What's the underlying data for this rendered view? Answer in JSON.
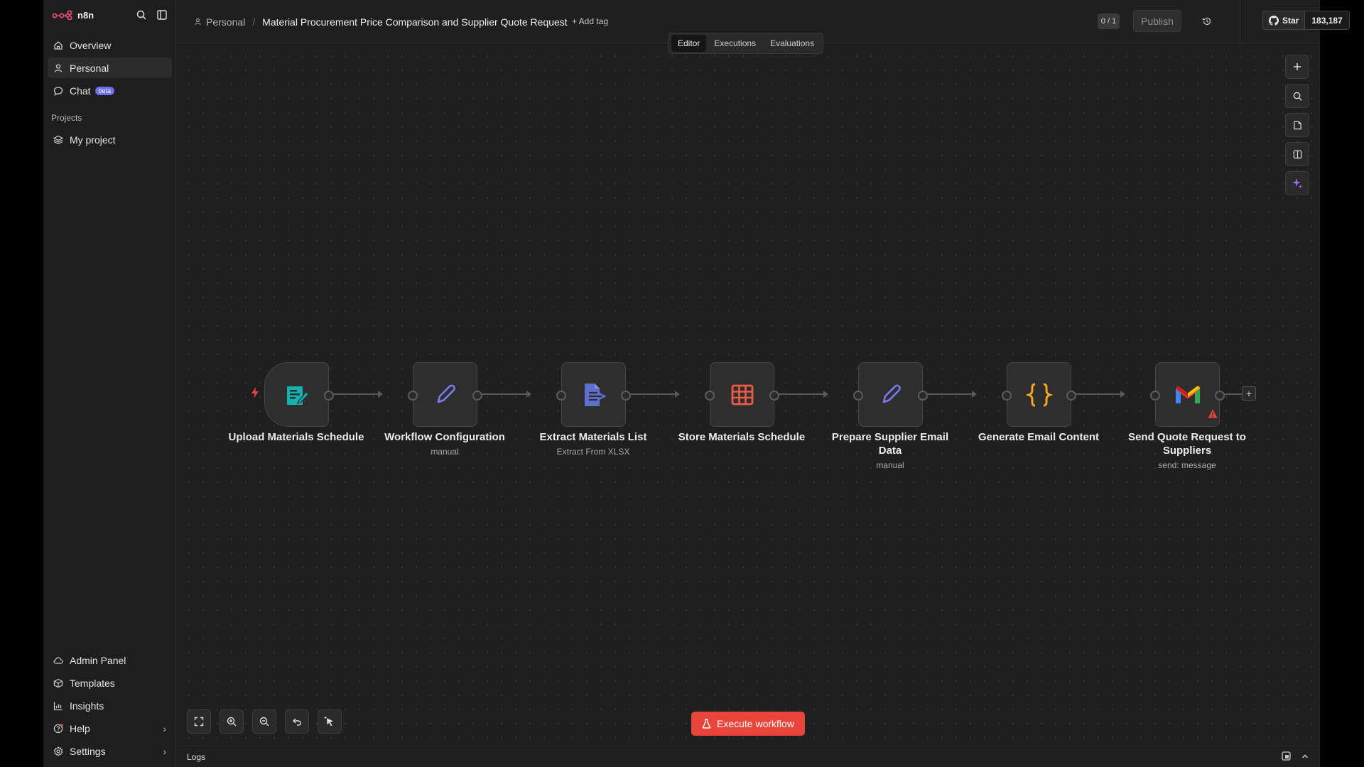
{
  "app": {
    "brand_name": "n8n"
  },
  "sidebar": {
    "items": [
      {
        "label": "Overview",
        "icon": "home-icon"
      },
      {
        "label": "Personal",
        "icon": "user-icon"
      },
      {
        "label": "Chat",
        "icon": "chat-icon",
        "badge": "beta"
      }
    ],
    "section_label": "Projects",
    "projects": [
      {
        "label": "My project",
        "icon": "layers-icon"
      }
    ],
    "bottom_items": [
      {
        "label": "Admin Panel",
        "icon": "cloud-icon"
      },
      {
        "label": "Templates",
        "icon": "box-icon"
      },
      {
        "label": "Insights",
        "icon": "chart-icon"
      },
      {
        "label": "Help",
        "icon": "help-icon"
      },
      {
        "label": "Settings",
        "icon": "gear-icon"
      }
    ]
  },
  "header": {
    "owner": "Personal",
    "separator": "/",
    "workflow_title": "Material Procurement Price Comparison and Supplier Quote Request",
    "add_tag": "+ Add tag",
    "counter": "0 / 1",
    "publish_label": "Publish",
    "star_label": "Star",
    "star_count": "183,187",
    "tabs": [
      "Editor",
      "Executions",
      "Evaluations"
    ]
  },
  "nodes": [
    {
      "label": "Upload Materials Schedule",
      "subtitle": "",
      "icon": "form-icon",
      "color": "#14b3b0"
    },
    {
      "label": "Workflow Configuration",
      "subtitle": "manual",
      "icon": "pencil-icon",
      "color": "#7b7bf0"
    },
    {
      "label": "Extract Materials List",
      "subtitle": "Extract From XLSX",
      "icon": "file-extract-icon",
      "color": "#5f6fce"
    },
    {
      "label": "Store Materials Schedule",
      "subtitle": "",
      "icon": "table-icon",
      "color": "#ef5b46"
    },
    {
      "label": "Prepare Supplier Email Data",
      "subtitle": "manual",
      "icon": "pencil-icon",
      "color": "#7b7bf0"
    },
    {
      "label": "Generate Email Content",
      "subtitle": "",
      "icon": "code-braces-icon",
      "color": "#f5a623"
    },
    {
      "label": "Send Quote Request to Suppliers",
      "subtitle": "send: message",
      "icon": "gmail-icon",
      "color": "#ea4335"
    }
  ],
  "execute_label": "Execute workflow",
  "logs_label": "Logs",
  "colors": {
    "accent": "#e8443a",
    "canvas": "#1f1f1f"
  }
}
